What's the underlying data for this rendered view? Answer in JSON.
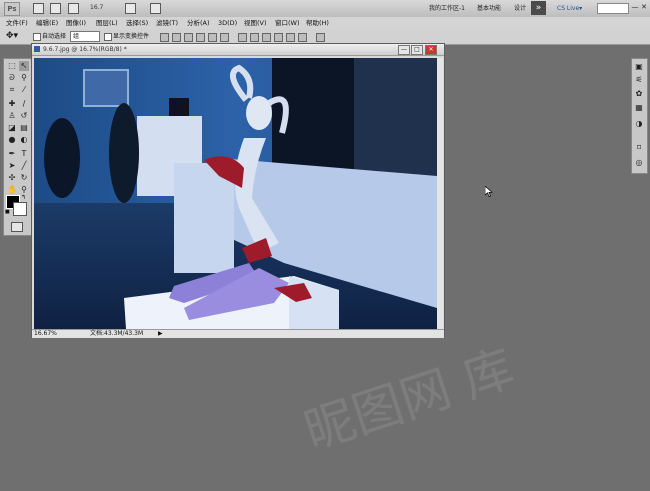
{
  "app": {
    "logo_text": "Ps",
    "zoom_level": "16.7",
    "workspace_buttons": [
      "我的工作区-1",
      "基本功能",
      "设计"
    ],
    "overflow_label": "»",
    "cs_live_label": "CS Live▾",
    "window_controls": [
      "—",
      "□",
      "✕"
    ]
  },
  "menu": {
    "items": [
      "文件(F)",
      "编辑(E)",
      "图像(I)",
      "图层(L)",
      "选择(S)",
      "滤镜(T)",
      "分析(A)",
      "3D(D)",
      "视图(V)",
      "窗口(W)",
      "帮助(H)"
    ]
  },
  "options_bar": {
    "auto_select_label": "自动选择",
    "layer_select_value": "组",
    "show_transform_label": "显示变换控件"
  },
  "document": {
    "title": "9.6.7.jpg @ 16.7%(RGB/8) *",
    "controls": [
      "—",
      "□",
      "✕"
    ],
    "zoom": "16.67%",
    "doc_size": "文档:43.3M/43.3M",
    "status_arrow": "▶"
  },
  "watermark_text": "昵图网 库",
  "colors": {
    "accent": "#2d5ca8",
    "foreground_color": "#000000",
    "background_color": "#ffffff"
  }
}
